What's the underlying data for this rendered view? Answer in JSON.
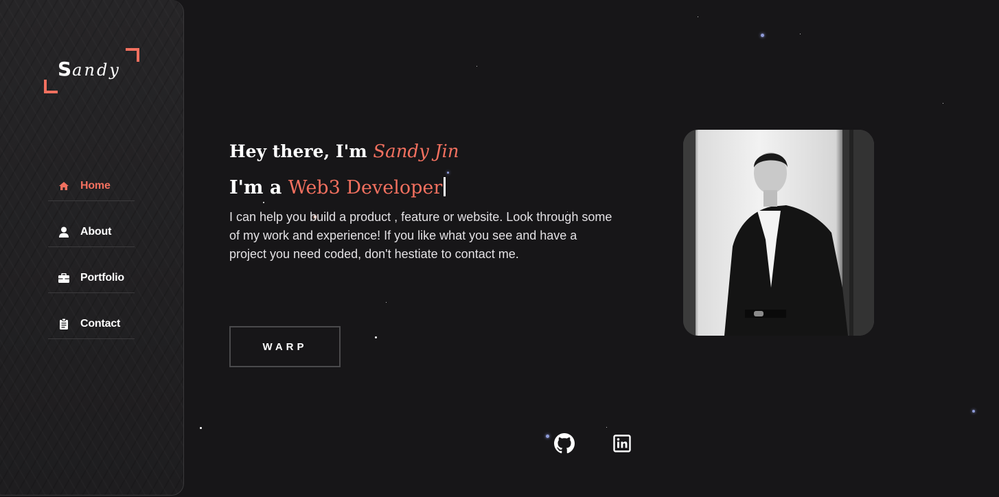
{
  "sidebar": {
    "logo": {
      "initial": "S",
      "rest": "andy"
    },
    "items": [
      {
        "label": "Home",
        "icon": "home-icon",
        "active": true
      },
      {
        "label": "About",
        "icon": "user-icon",
        "active": false
      },
      {
        "label": "Portfolio",
        "icon": "briefcase-icon",
        "active": false
      },
      {
        "label": "Contact",
        "icon": "clipboard-icon",
        "active": false
      }
    ]
  },
  "hero": {
    "greeting_prefix": "Hey there, I'm ",
    "name": "Sandy Jin",
    "role_prefix": "I'm a ",
    "role": "Web3 Developer",
    "bio": "I can help you build a product , feature or website. Look through some of my work and experience! If you like what you see and have a project you need coded, don't hestiate to contact me.",
    "button_label": "WARP"
  },
  "socials": [
    {
      "icon": "github-icon"
    },
    {
      "icon": "linkedin-icon"
    }
  ],
  "colors": {
    "accent": "#f2705f",
    "background": "#171618",
    "sidebar": "#1f1e20"
  }
}
